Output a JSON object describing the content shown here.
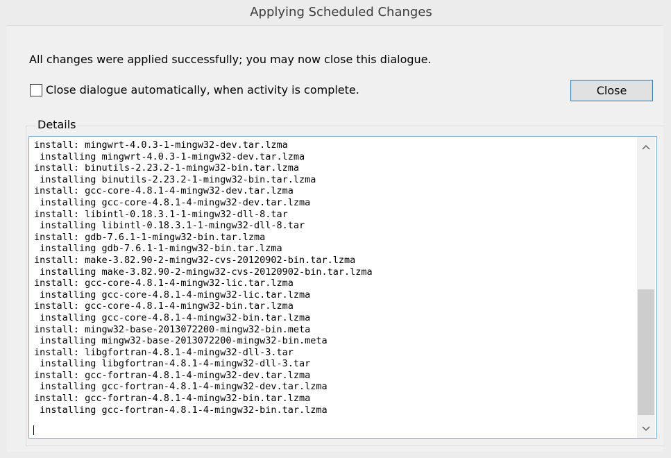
{
  "window": {
    "title": "Applying Scheduled Changes"
  },
  "message": "All changes were applied successfully; you may now close this dialogue.",
  "auto_close": {
    "label": "Close dialogue automatically, when activity is complete.",
    "checked": false
  },
  "close_button": {
    "label": "Close"
  },
  "details": {
    "legend": "Details",
    "lines": [
      "install: mingwrt-4.0.3-1-mingw32-dev.tar.lzma",
      " installing mingwrt-4.0.3-1-mingw32-dev.tar.lzma",
      "install: binutils-2.23.2-1-mingw32-bin.tar.lzma",
      " installing binutils-2.23.2-1-mingw32-bin.tar.lzma",
      "install: gcc-core-4.8.1-4-mingw32-dev.tar.lzma",
      " installing gcc-core-4.8.1-4-mingw32-dev.tar.lzma",
      "install: libintl-0.18.3.1-1-mingw32-dll-8.tar",
      " installing libintl-0.18.3.1-1-mingw32-dll-8.tar",
      "install: gdb-7.6.1-1-mingw32-bin.tar.lzma",
      " installing gdb-7.6.1-1-mingw32-bin.tar.lzma",
      "install: make-3.82.90-2-mingw32-cvs-20120902-bin.tar.lzma",
      " installing make-3.82.90-2-mingw32-cvs-20120902-bin.tar.lzma",
      "install: gcc-core-4.8.1-4-mingw32-lic.tar.lzma",
      " installing gcc-core-4.8.1-4-mingw32-lic.tar.lzma",
      "install: gcc-core-4.8.1-4-mingw32-bin.tar.lzma",
      " installing gcc-core-4.8.1-4-mingw32-bin.tar.lzma",
      "install: mingw32-base-2013072200-mingw32-bin.meta",
      " installing mingw32-base-2013072200-mingw32-bin.meta",
      "install: libgfortran-4.8.1-4-mingw32-dll-3.tar",
      " installing libgfortran-4.8.1-4-mingw32-dll-3.tar",
      "install: gcc-fortran-4.8.1-4-mingw32-dev.tar.lzma",
      " installing gcc-fortran-4.8.1-4-mingw32-dev.tar.lzma",
      "install: gcc-fortran-4.8.1-4-mingw32-bin.tar.lzma",
      " installing gcc-fortran-4.8.1-4-mingw32-bin.tar.lzma"
    ]
  },
  "scrollbar": {
    "up_icon": "chevron-up-icon",
    "down_icon": "chevron-down-icon"
  }
}
